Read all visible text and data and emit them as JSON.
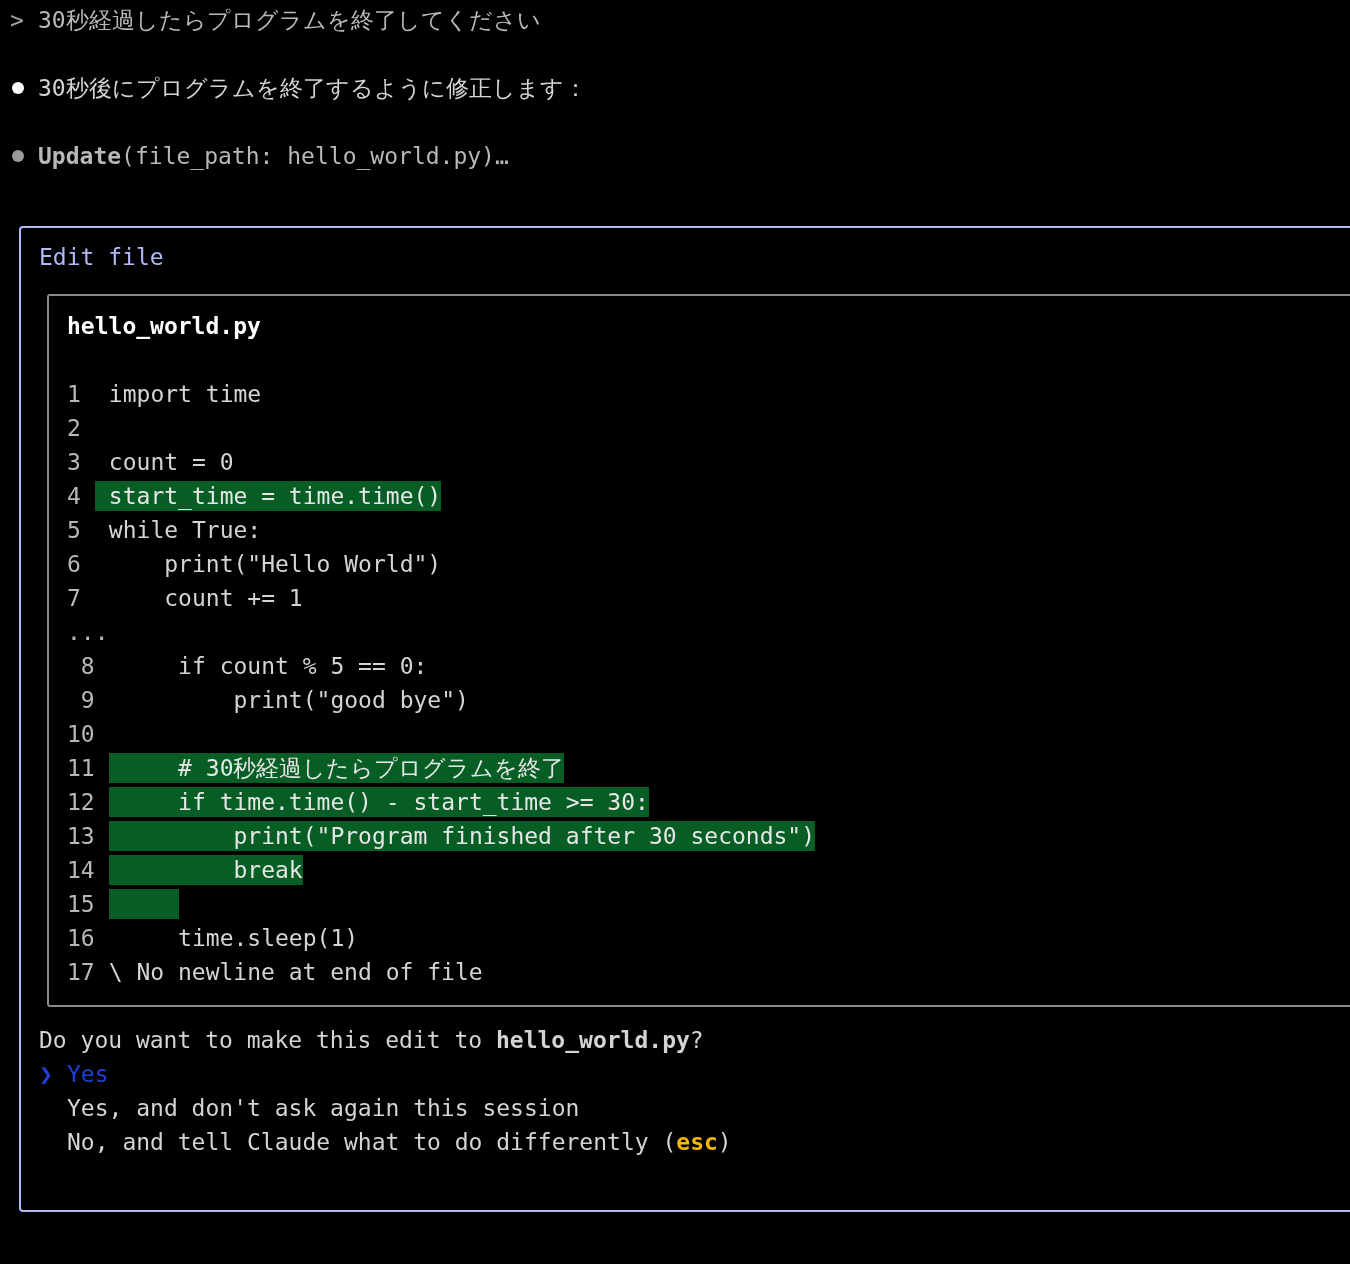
{
  "transcript": [
    {
      "kind": "prompt",
      "marker": ">",
      "text": "30秒経過したらプログラムを終了してください"
    },
    {
      "kind": "message",
      "color": "#ffffff",
      "text": "30秒後にプログラムを終了するように修正します："
    },
    {
      "kind": "tool",
      "color": "#9a9a9a",
      "text": "**Update**(file_path: hello_world.py)…"
    }
  ],
  "dialog": {
    "title": "Edit file",
    "diff": {
      "filename": "hello_world.py",
      "hunks": [
        {
          "lines": [
            {
              "number": "1",
              "text": "import time",
              "added": false
            },
            {
              "number": "2",
              "added": false
            },
            {
              "number": "3",
              "text": "count = 0",
              "added": false
            },
            {
              "number": "4",
              "text": "start_time = time.time()",
              "added": true
            },
            {
              "number": "5",
              "text": "while True:",
              "added": false
            },
            {
              "number": "6",
              "text": "    print(\"Hello World\")",
              "added": false
            },
            {
              "number": "7",
              "text": "    count += 1",
              "added": false
            }
          ]
        },
        {
          "separator": "...",
          "lines": [
            {
              "number": "8",
              "text": "    if count % 5 == 0:",
              "added": false
            },
            {
              "number": "9",
              "text": "        print(\"good bye\")",
              "added": false
            },
            {
              "number": "10",
              "added": false
            },
            {
              "number": "11",
              "text": "    # 30秒経過したらプログラムを終了",
              "added": true
            },
            {
              "number": "12",
              "text": "    if time.time() - start_time >= 30:",
              "added": true
            },
            {
              "number": "13",
              "text": "        print(\"Program finished after 30 seconds\")",
              "added": true
            },
            {
              "number": "14",
              "text": "        break",
              "added": true
            },
            {
              "number": "15",
              "added": true
            },
            {
              "number": "16",
              "text": "    time.sleep(1)",
              "added": false
            },
            {
              "number": "17",
              "note": "\\ No newline at end of file",
              "added": false
            }
          ]
        }
      ]
    },
    "question": "Do you want to make this edit to **hello_world.py**?",
    "pointer": "❯",
    "options": [
      {
        "label": "Yes",
        "selected": true
      },
      {
        "label": "Yes, and don't ask again this session",
        "selected": false
      },
      {
        "label": "No, and tell Claude what to do differently (",
        "shortcut": "esc",
        "label_after": ")",
        "selected": false
      }
    ]
  }
}
